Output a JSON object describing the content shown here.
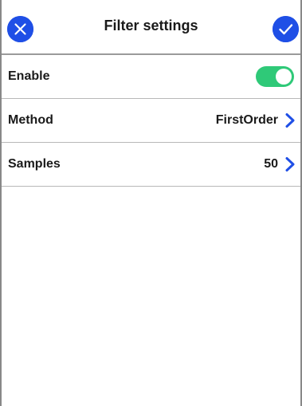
{
  "header": {
    "title": "Filter settings",
    "close_icon": "close-icon",
    "confirm_icon": "checkmark-icon"
  },
  "rows": [
    {
      "label": "Enable",
      "type": "toggle",
      "checked": true
    },
    {
      "label": "Method",
      "type": "select",
      "value": "FirstOrder"
    },
    {
      "label": "Samples",
      "type": "select",
      "value": "50"
    }
  ],
  "colors": {
    "accent": "#1f4fe6",
    "toggle_on": "#2fc978"
  }
}
